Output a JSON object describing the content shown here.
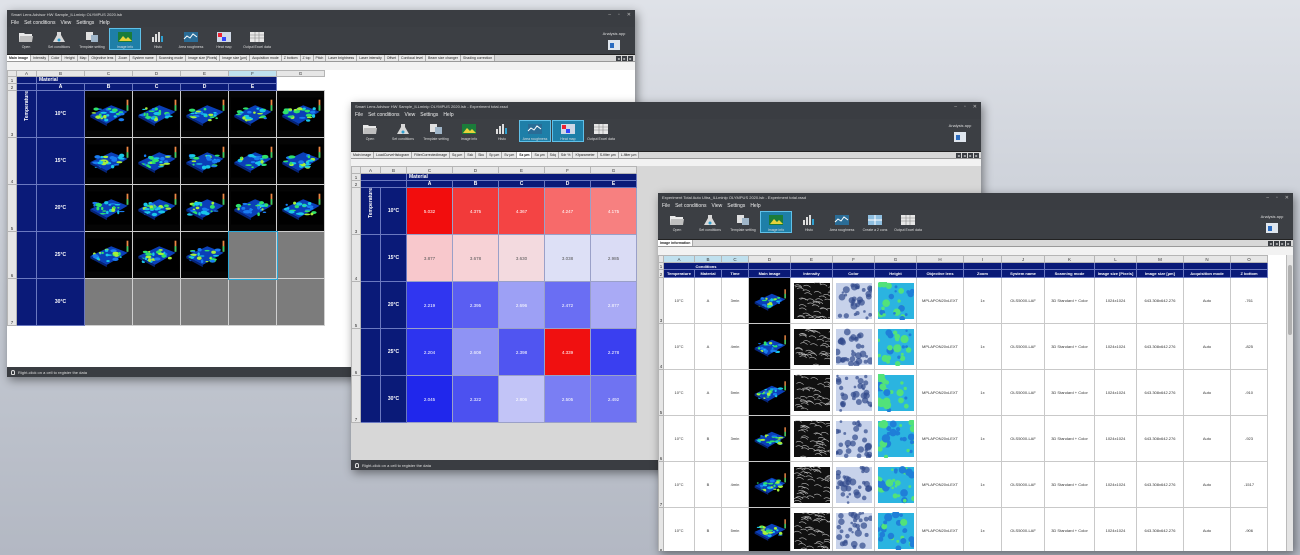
{
  "window1": {
    "title": "Smart Lens Advisor HW Sample_ILLminip OLYMPUS 2020.lsb",
    "menu": [
      "File",
      "Set conditions",
      "View",
      "Settings",
      "Help"
    ],
    "ribbon": [
      "Open",
      "Set conditions",
      "Template setting",
      "Image info",
      "Histo",
      "Area roughness",
      "Heat map",
      "Output Excel data"
    ],
    "active_ribbon": "Image info",
    "analysis_label": "Analysis app",
    "tabs": [
      "Main image",
      "Intensity",
      "Color",
      "Height",
      "Map",
      "Objective lens",
      "Zoom",
      "System name",
      "Scanning mode",
      "Image size [Pixels]",
      "Image size [µm]",
      "Acquisition mode",
      "Z bottom",
      "Z top",
      "Pitch",
      "Laser brightness",
      "Laser intensity",
      "Offset",
      "Confocal level",
      "Beam size changer",
      "Shading correction"
    ],
    "active_tab": "Main image",
    "columns": [
      "A",
      "B",
      "C",
      "D",
      "E",
      "F",
      "G"
    ],
    "selected_column": "F",
    "rows": [
      "1",
      "2",
      "3",
      "4",
      "5",
      "6",
      "7"
    ],
    "material_label": "Material",
    "temperature_label": "Temperature",
    "materials": [
      "A",
      "B",
      "C",
      "D",
      "E"
    ],
    "temperatures": [
      "10°C",
      "15°C",
      "20°C",
      "25°C",
      "30°C"
    ],
    "image_counts": [
      5,
      5,
      5,
      3,
      0
    ],
    "status": "Right-click on a cell to register the data"
  },
  "window2": {
    "title": "Smart Lens Advisor HW Sample_ILLminip OLYMPUS 2020.lsb - Experiment total.xssd",
    "menu": [
      "File",
      "Set conditions",
      "View",
      "Settings",
      "Help"
    ],
    "ribbon": [
      "Open",
      "Set conditions",
      "Template setting",
      "Image info",
      "Histo",
      "Area roughness",
      "Heat map",
      "Output Excel data"
    ],
    "active_ribbons": [
      "Area roughness",
      "Heat map"
    ],
    "analysis_label": "Analysis app",
    "tabs": [
      "Main image",
      "LoadCurveHistogram",
      "FilterCorrectedImage",
      "Sq µm",
      "Ssk",
      "Sku",
      "Sp µm",
      "Sv µm",
      "Sz µm",
      "Sa µm",
      "Sdq",
      "Sdr %",
      "Kfparameter",
      "S-filter µm",
      "L-filter µm"
    ],
    "active_tab": "Sz µm",
    "columns": [
      "A",
      "B",
      "C",
      "D",
      "E",
      "F",
      "G"
    ],
    "rows": [
      "1",
      "2",
      "3",
      "4",
      "5",
      "6",
      "7"
    ],
    "material_label": "Material",
    "temperature_label": "Temperature",
    "materials": [
      "A",
      "B",
      "C",
      "D",
      "E"
    ],
    "temperatures": [
      "10°C",
      "15°C",
      "20°C",
      "25°C",
      "30°C"
    ],
    "heat_values": [
      [
        "5.032",
        "4.375",
        "4.367",
        "4.247",
        "4.175"
      ],
      [
        "3.877",
        "3.678",
        "3.630",
        "3.038",
        "2.985"
      ],
      [
        "2.219",
        "2.395",
        "2.696",
        "2.472",
        "2.877"
      ],
      [
        "2.204",
        "2.608",
        "2.398",
        "4.339",
        "2.278"
      ],
      [
        "2.045",
        "2.322",
        "2.806",
        "2.505",
        "2.492"
      ]
    ],
    "heat_colors": [
      [
        "#f20d0d",
        "#f23a3a",
        "#f44444",
        "#f76a6a",
        "#f78080"
      ],
      [
        "#f8c8cc",
        "#f7d2d6",
        "#f3dadf",
        "#dde0f6",
        "#dadcf5"
      ],
      [
        "#3036f0",
        "#5a5ef2",
        "#9da0f5",
        "#6a6ef3",
        "#a9aaf5"
      ],
      [
        "#2d34ef",
        "#8f93f4",
        "#5055f1",
        "#f01010",
        "#3a3ff0"
      ],
      [
        "#2027ec",
        "#4c51f0",
        "#c2c4f7",
        "#7a7ef3",
        "#6f73f2"
      ]
    ],
    "status": "Right-click on a cell to register the data"
  },
  "window3": {
    "title": "Experiment Total Auto Ultra_ILLminip OLYMPUS 2020.lsb - Experiment total.xssd",
    "menu": [
      "File",
      "Set conditions",
      "View",
      "Settings",
      "Help"
    ],
    "ribbon": [
      "Open",
      "Set conditions",
      "Template setting",
      "Image info",
      "Histo",
      "Area roughness",
      "Create a 2 cons",
      "Output Excel data"
    ],
    "active_ribbon": "Image info",
    "analysis_label": "Analysis app",
    "tab": "Image information",
    "columns": [
      "A",
      "B",
      "C",
      "D",
      "E",
      "F",
      "G",
      "H",
      "I",
      "J",
      "K",
      "L",
      "M",
      "N",
      "O"
    ],
    "conditions_label": "Conditions",
    "headers": [
      "Temperature",
      "Material",
      "Time",
      "Main image",
      "Intensity",
      "Color",
      "Height",
      "Objective lens",
      "Zoom",
      "System name",
      "Scanning mode",
      "Image size [Pixels]",
      "Image size [µm]",
      "Acquisition mode",
      "Z bottom"
    ],
    "rows": [
      {
        "n": "3",
        "temp": "10°C",
        "mat": "A",
        "time": "3min",
        "lens": "MPLAPON20xLEXT",
        "zoom": "1x",
        "sys": "OLS5000-LAF",
        "mode": "3D Standard + Color",
        "px": "1024x1024",
        "um": "643.308x642.276",
        "acq": "Auto",
        "zb": "-761"
      },
      {
        "n": "4",
        "temp": "10°C",
        "mat": "A",
        "time": "4min",
        "lens": "MPLAPON20xLEXT",
        "zoom": "1x",
        "sys": "OLS5000-LAF",
        "mode": "3D Standard + Color",
        "px": "1024x1024",
        "um": "643.308x642.276",
        "acq": "Auto",
        "zb": "-825"
      },
      {
        "n": "5",
        "temp": "10°C",
        "mat": "A",
        "time": "5min",
        "lens": "MPLAPON20xLEXT",
        "zoom": "1x",
        "sys": "OLS5000-LAF",
        "mode": "3D Standard + Color",
        "px": "1024x1024",
        "um": "643.308x642.276",
        "acq": "Auto",
        "zb": "-910"
      },
      {
        "n": "6",
        "temp": "10°C",
        "mat": "B",
        "time": "3min",
        "lens": "MPLAPON20xLEXT",
        "zoom": "1x",
        "sys": "OLS5000-LAF",
        "mode": "3D Standard + Color",
        "px": "1024x1024",
        "um": "643.308x642.276",
        "acq": "Auto",
        "zb": "-923"
      },
      {
        "n": "7",
        "temp": "10°C",
        "mat": "B",
        "time": "4min",
        "lens": "MPLAPON20xLEXT",
        "zoom": "1x",
        "sys": "OLS5000-LAF",
        "mode": "3D Standard + Color",
        "px": "1024x1024",
        "um": "643.308x642.276",
        "acq": "Auto",
        "zb": "-1517"
      },
      {
        "n": "8",
        "temp": "10°C",
        "mat": "B",
        "time": "5min",
        "lens": "MPLAPON20xLEXT",
        "zoom": "1x",
        "sys": "OLS5000-LAF",
        "mode": "3D Standard + Color",
        "px": "1024x1024",
        "um": "643.308x642.276",
        "acq": "Auto",
        "zb": "-906"
      }
    ]
  },
  "icons": {
    "open": "folder-icon",
    "set_conditions": "flask-icon",
    "template": "template-icon",
    "image_info": "image-icon",
    "histo": "histogram-icon",
    "area": "roughness-icon",
    "heat": "heatmap-icon",
    "excel": "excel-icon",
    "analysis": "analysis-app-icon"
  }
}
